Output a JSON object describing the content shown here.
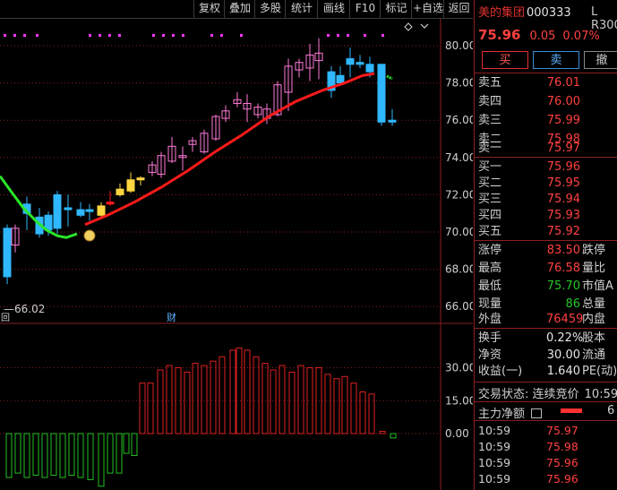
{
  "toolbar": {
    "buttons": [
      "复权",
      "叠加",
      "多股",
      "统计",
      "画线",
      "F10",
      "标记",
      "+自选",
      "返回"
    ]
  },
  "chart": {
    "price_axis_labels": [
      "80.00",
      "78.00",
      "76.00",
      "74.00",
      "72.00",
      "70.00",
      "68.00",
      "66.00"
    ],
    "low_label": "66.02",
    "bottom_tag_left": "回",
    "bottom_tag_mid": "财",
    "indicator_axis_labels": [
      "30.00",
      "15.00",
      "0.00"
    ],
    "colors": {
      "up_candle": "#ff7ad8",
      "down_candle": "#2fb8ff",
      "yellow_candle": "#ffd640",
      "ma_red": "#ff1a1a",
      "ma_green": "#29e629",
      "macd_up": "#e02020",
      "macd_down": "#22c022",
      "dot": "#ff33ff"
    }
  },
  "quote": {
    "name": "美的集团",
    "code": "000333",
    "tag": "L R300",
    "price": "75.96",
    "change": "0.05",
    "percent": "0.07%"
  },
  "actions": {
    "buy": "买",
    "sell": "卖",
    "cancel": "撤"
  },
  "asks": [
    {
      "label": "卖五",
      "price": "76.01"
    },
    {
      "label": "卖四",
      "price": "76.00"
    },
    {
      "label": "卖三",
      "price": "75.99"
    },
    {
      "label": "卖二",
      "price": "75.98"
    },
    {
      "label": "卖一",
      "price": "75.97"
    }
  ],
  "bids": [
    {
      "label": "买一",
      "price": "75.96"
    },
    {
      "label": "买二",
      "price": "75.95"
    },
    {
      "label": "买三",
      "price": "75.94"
    },
    {
      "label": "买四",
      "price": "75.93"
    },
    {
      "label": "买五",
      "price": "75.92"
    }
  ],
  "stats": [
    {
      "label": "涨停",
      "value": "83.50",
      "color": "red",
      "label2": "跌停"
    },
    {
      "label": "最高",
      "value": "76.58",
      "color": "red",
      "label2": "量比"
    },
    {
      "label": "最低",
      "value": "75.70",
      "color": "green",
      "label2": "市值A"
    },
    {
      "label": "现量",
      "value": "86",
      "color": "green",
      "label2": "总量"
    },
    {
      "label": "外盘",
      "value": "76459",
      "color": "red",
      "label2": "内盘"
    }
  ],
  "stats2": [
    {
      "label": "换手",
      "value": "0.22%",
      "label2": "股本"
    },
    {
      "label": "净资",
      "value": "30.00",
      "label2": "流通"
    },
    {
      "label": "收益(一)",
      "value": "1.640",
      "label2": "PE(动)"
    }
  ],
  "status": {
    "trade_state": "交易状态: 连续竞价",
    "time": "10:59",
    "main_flow_label": "主力净额",
    "main_flow_value": "6"
  },
  "ticks": [
    {
      "time": "10:59",
      "price": "75.97"
    },
    {
      "time": "10:59",
      "price": "75.98"
    },
    {
      "time": "10:59",
      "price": "75.96"
    },
    {
      "time": "10:59",
      "price": "75.96"
    }
  ]
}
